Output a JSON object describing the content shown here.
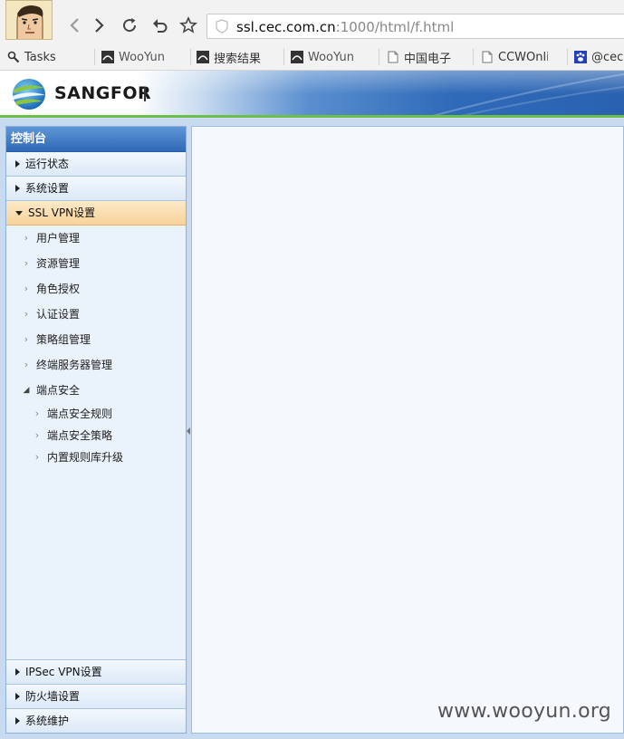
{
  "browser": {
    "url_host": "ssl.cec.com.cn",
    "url_rest": ":1000/html/f.html",
    "bookmarks": [
      {
        "label": "Tasks",
        "icon": "wrench-icon"
      },
      {
        "label": "WooYun",
        "icon": "wooyun-icon"
      },
      {
        "label": "搜索结果",
        "icon": "wooyun-icon"
      },
      {
        "label": "WooYun",
        "icon": "wooyun-icon"
      },
      {
        "label": "中国电子",
        "icon": "page-icon"
      },
      {
        "label": "CCWOnli",
        "icon": "page-icon"
      },
      {
        "label": "@cec.",
        "icon": "paw-icon"
      }
    ]
  },
  "header": {
    "logo_text": "SANGFOR"
  },
  "sidebar": {
    "title": "控制台",
    "sections_top": [
      {
        "label": "运行状态"
      },
      {
        "label": "系统设置"
      }
    ],
    "active_section": "SSL VPN设置",
    "items": [
      {
        "label": "用户管理"
      },
      {
        "label": "资源管理"
      },
      {
        "label": "角色授权"
      },
      {
        "label": "认证设置"
      },
      {
        "label": "策略组管理"
      },
      {
        "label": "终端服务器管理"
      }
    ],
    "open_item": "端点安全",
    "sub_items": [
      {
        "label": "端点安全规则"
      },
      {
        "label": "端点安全策略"
      },
      {
        "label": "内置规则库升级"
      }
    ],
    "sections_bottom": [
      {
        "label": "IPSec VPN设置"
      },
      {
        "label": "防火墙设置"
      },
      {
        "label": "系统维护"
      }
    ]
  },
  "watermark": "www.wooyun.org",
  "colors": {
    "sidebar_title": "#2f69b6",
    "active_section": "#f8d39a",
    "content_bg": "#f5f9fd"
  }
}
